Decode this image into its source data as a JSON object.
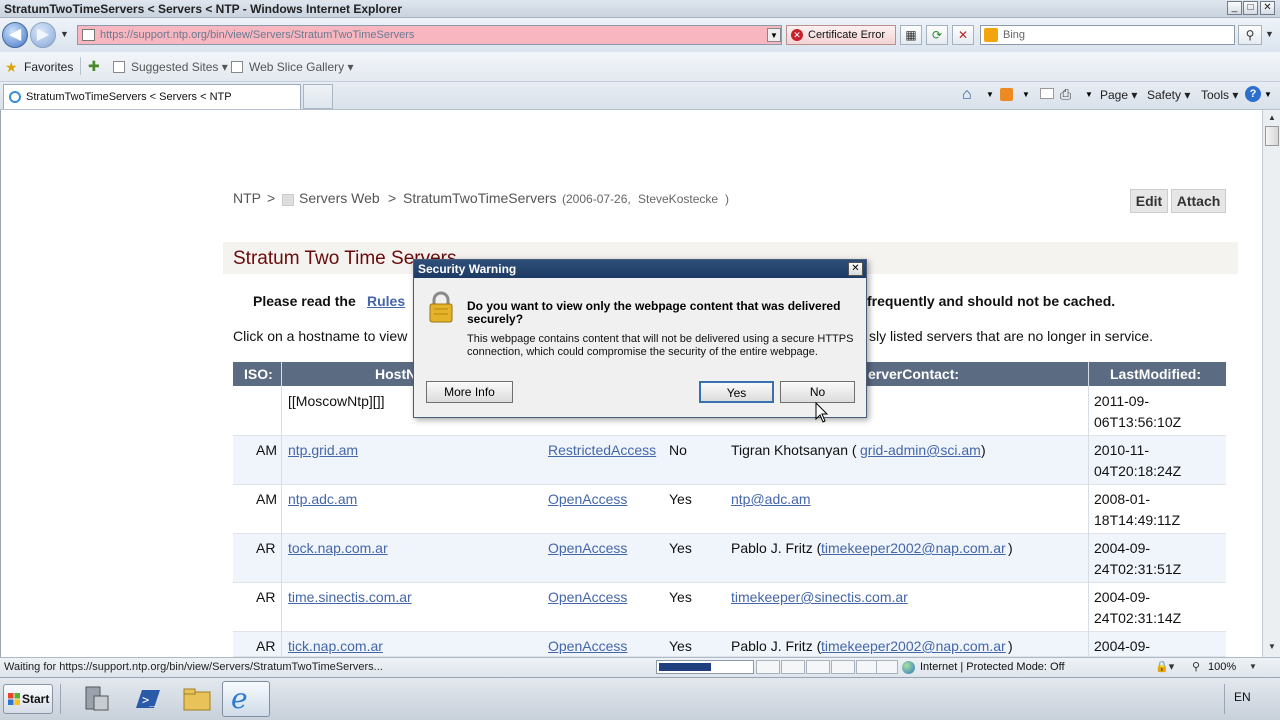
{
  "window": {
    "title": "StratumTwoTimeServers < Servers < NTP - Windows Internet Explorer",
    "controls": [
      "_",
      "□",
      "✕"
    ]
  },
  "navbar": {
    "url": "https://support.ntp.org/bin/view/Servers/StratumTwoTimeServers",
    "certificate_label": "Certificate Error",
    "search_placeholder": "Bing"
  },
  "favorites_bar": {
    "favorites_label": "Favorites",
    "suggested_sites": "Suggested Sites ▾",
    "web_slice_gallery": "Web Slice Gallery ▾"
  },
  "tab": {
    "label": "StratumTwoTimeServers < Servers < NTP"
  },
  "command_bar": {
    "page": "Page ▾",
    "safety": "Safety ▾",
    "tools": "Tools ▾"
  },
  "page": {
    "breadcrumb": {
      "root": "NTP",
      "sep1": ">",
      "web": "Servers Web",
      "sep2": ">",
      "current": "StratumTwoTimeServers",
      "meta_prefix": "(2006-07-26, ",
      "meta_author": "SteveKostecke",
      "meta_suffix": ")"
    },
    "buttons": {
      "edit": "Edit",
      "attach": "Attach"
    },
    "title": "Stratum Two Time Servers",
    "notice_prefix": "Please read the ",
    "notice_link": "Rules",
    "notice_suffix": "frequently and should not be cached.",
    "intro_prefix": "Click on a hostname to view",
    "intro_suffix": "sly listed servers that are no longer in service.",
    "table": {
      "headers": {
        "iso": "ISO:",
        "host": "HostN",
        "contact": "erverContact:",
        "modified": "LastModified:"
      },
      "rows": [
        {
          "iso": "",
          "host": "[[MoscowNtp][]]",
          "access": "",
          "notify": "",
          "contact_name": "",
          "contact_link": "",
          "contact_close": "",
          "modified_1": "2011-09-",
          "modified_2": "06T13:56:10Z"
        },
        {
          "iso": "AM",
          "host": "ntp.grid.am",
          "access": "RestrictedAccess",
          "notify": "No",
          "contact_name": "Tigran Khotsanyan (",
          "contact_link": "grid-admin@sci.am",
          "contact_close": ")",
          "modified_1": "2010-11-",
          "modified_2": "04T20:18:24Z"
        },
        {
          "iso": "AM",
          "host": "ntp.adc.am",
          "access": "OpenAccess",
          "notify": "Yes",
          "contact_name": "",
          "contact_link": "ntp@adc.am",
          "contact_close": "",
          "modified_1": "2008-01-",
          "modified_2": "18T14:49:11Z"
        },
        {
          "iso": "AR",
          "host": "tock.nap.com.ar",
          "access": "OpenAccess",
          "notify": "Yes",
          "contact_name": "Pablo J. Fritz (",
          "contact_link": "timekeeper2002@nap.com.ar",
          "contact_close": ")",
          "modified_1": "2004-09-",
          "modified_2": "24T02:31:51Z"
        },
        {
          "iso": "AR",
          "host": "time.sinectis.com.ar",
          "access": "OpenAccess",
          "notify": "Yes",
          "contact_name": "",
          "contact_link": "timekeeper@sinectis.com.ar",
          "contact_close": "",
          "modified_1": "2004-09-",
          "modified_2": "24T02:31:14Z"
        },
        {
          "iso": "AR",
          "host": "tick.nap.com.ar",
          "access": "OpenAccess",
          "notify": "Yes",
          "contact_name": "Pablo J. Fritz (",
          "contact_link": "timekeeper2002@nap.com.ar",
          "contact_close": ")",
          "modified_1": "2004-09-",
          "modified_2": ""
        }
      ]
    }
  },
  "dialog": {
    "title": "Security Warning",
    "question": "Do you want to view only the webpage content that was delivered securely?",
    "detail": "This webpage contains content that will not be delivered using a secure HTTPS connection, which could compromise the security of the entire webpage.",
    "more_info": "More Info",
    "yes": "Yes",
    "no": "No"
  },
  "statusbar": {
    "text": "Waiting for https://support.ntp.org/bin/view/Servers/StratumTwoTimeServers...",
    "zone": "Internet | Protected Mode: Off",
    "zoom": "100%"
  },
  "taskbar": {
    "start": "Start",
    "lang": "EN"
  },
  "colors": {
    "address_error": "#f7b6c0",
    "table_header": "#5b6b82",
    "page_title": "#6a0a0a",
    "link": "#4466aa",
    "dialog_title": "#1c3a63"
  }
}
